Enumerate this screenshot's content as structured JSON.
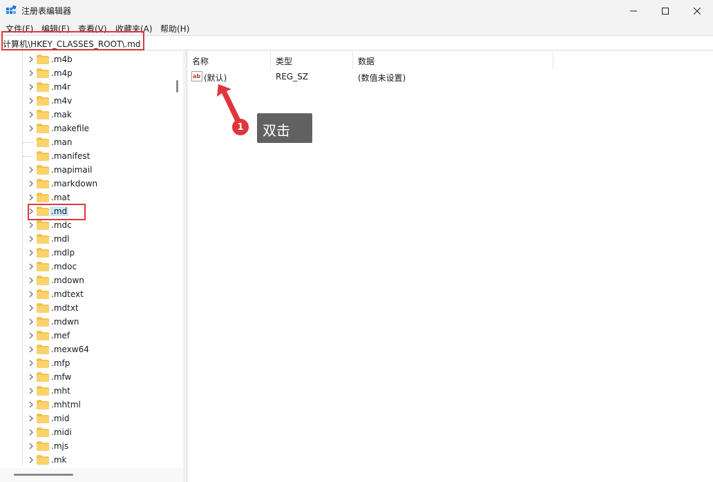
{
  "window": {
    "title": "注册表编辑器",
    "app_icon": "registry-editor-icon",
    "controls": [
      "minimize-icon",
      "maximize-icon",
      "close-icon"
    ]
  },
  "menu": [
    "文件(F)",
    "编辑(E)",
    "查看(V)",
    "收藏夹(A)",
    "帮助(H)"
  ],
  "address": "计算机\\HKEY_CLASSES_ROOT\\.md",
  "tree": {
    "items": [
      {
        "label": ".m4b",
        "has_children": true
      },
      {
        "label": ".m4p",
        "has_children": true
      },
      {
        "label": ".m4r",
        "has_children": true
      },
      {
        "label": ".m4v",
        "has_children": true
      },
      {
        "label": ".mak",
        "has_children": true
      },
      {
        "label": ".makefile",
        "has_children": true
      },
      {
        "label": ".man",
        "has_children": false
      },
      {
        "label": ".manifest",
        "has_children": false
      },
      {
        "label": ".mapimail",
        "has_children": true
      },
      {
        "label": ".markdown",
        "has_children": true
      },
      {
        "label": ".mat",
        "has_children": true
      },
      {
        "label": ".md",
        "has_children": true,
        "selected": true
      },
      {
        "label": ".mdc",
        "has_children": true
      },
      {
        "label": ".mdl",
        "has_children": true
      },
      {
        "label": ".mdlp",
        "has_children": true
      },
      {
        "label": ".mdoc",
        "has_children": true
      },
      {
        "label": ".mdown",
        "has_children": true
      },
      {
        "label": ".mdtext",
        "has_children": true
      },
      {
        "label": ".mdtxt",
        "has_children": true
      },
      {
        "label": ".mdwn",
        "has_children": true
      },
      {
        "label": ".mef",
        "has_children": true
      },
      {
        "label": ".mexw64",
        "has_children": true
      },
      {
        "label": ".mfp",
        "has_children": true
      },
      {
        "label": ".mfw",
        "has_children": true
      },
      {
        "label": ".mht",
        "has_children": true
      },
      {
        "label": ".mhtml",
        "has_children": true
      },
      {
        "label": ".mid",
        "has_children": true
      },
      {
        "label": ".midi",
        "has_children": true
      },
      {
        "label": ".mjs",
        "has_children": true
      },
      {
        "label": ".mk",
        "has_children": true
      }
    ]
  },
  "list": {
    "headers": {
      "name": "名称",
      "type": "类型",
      "data": "数据"
    },
    "rows": [
      {
        "name": "(默认)",
        "type": "REG_SZ",
        "data": "(数值未设置)",
        "icon": "string-value-icon"
      }
    ]
  },
  "annotation": {
    "step": "1",
    "text": "双击",
    "color": "#e0353b"
  },
  "colors": {
    "highlight": "#e0353b",
    "selection": "#cce8ff",
    "folder": "#f6c343"
  }
}
